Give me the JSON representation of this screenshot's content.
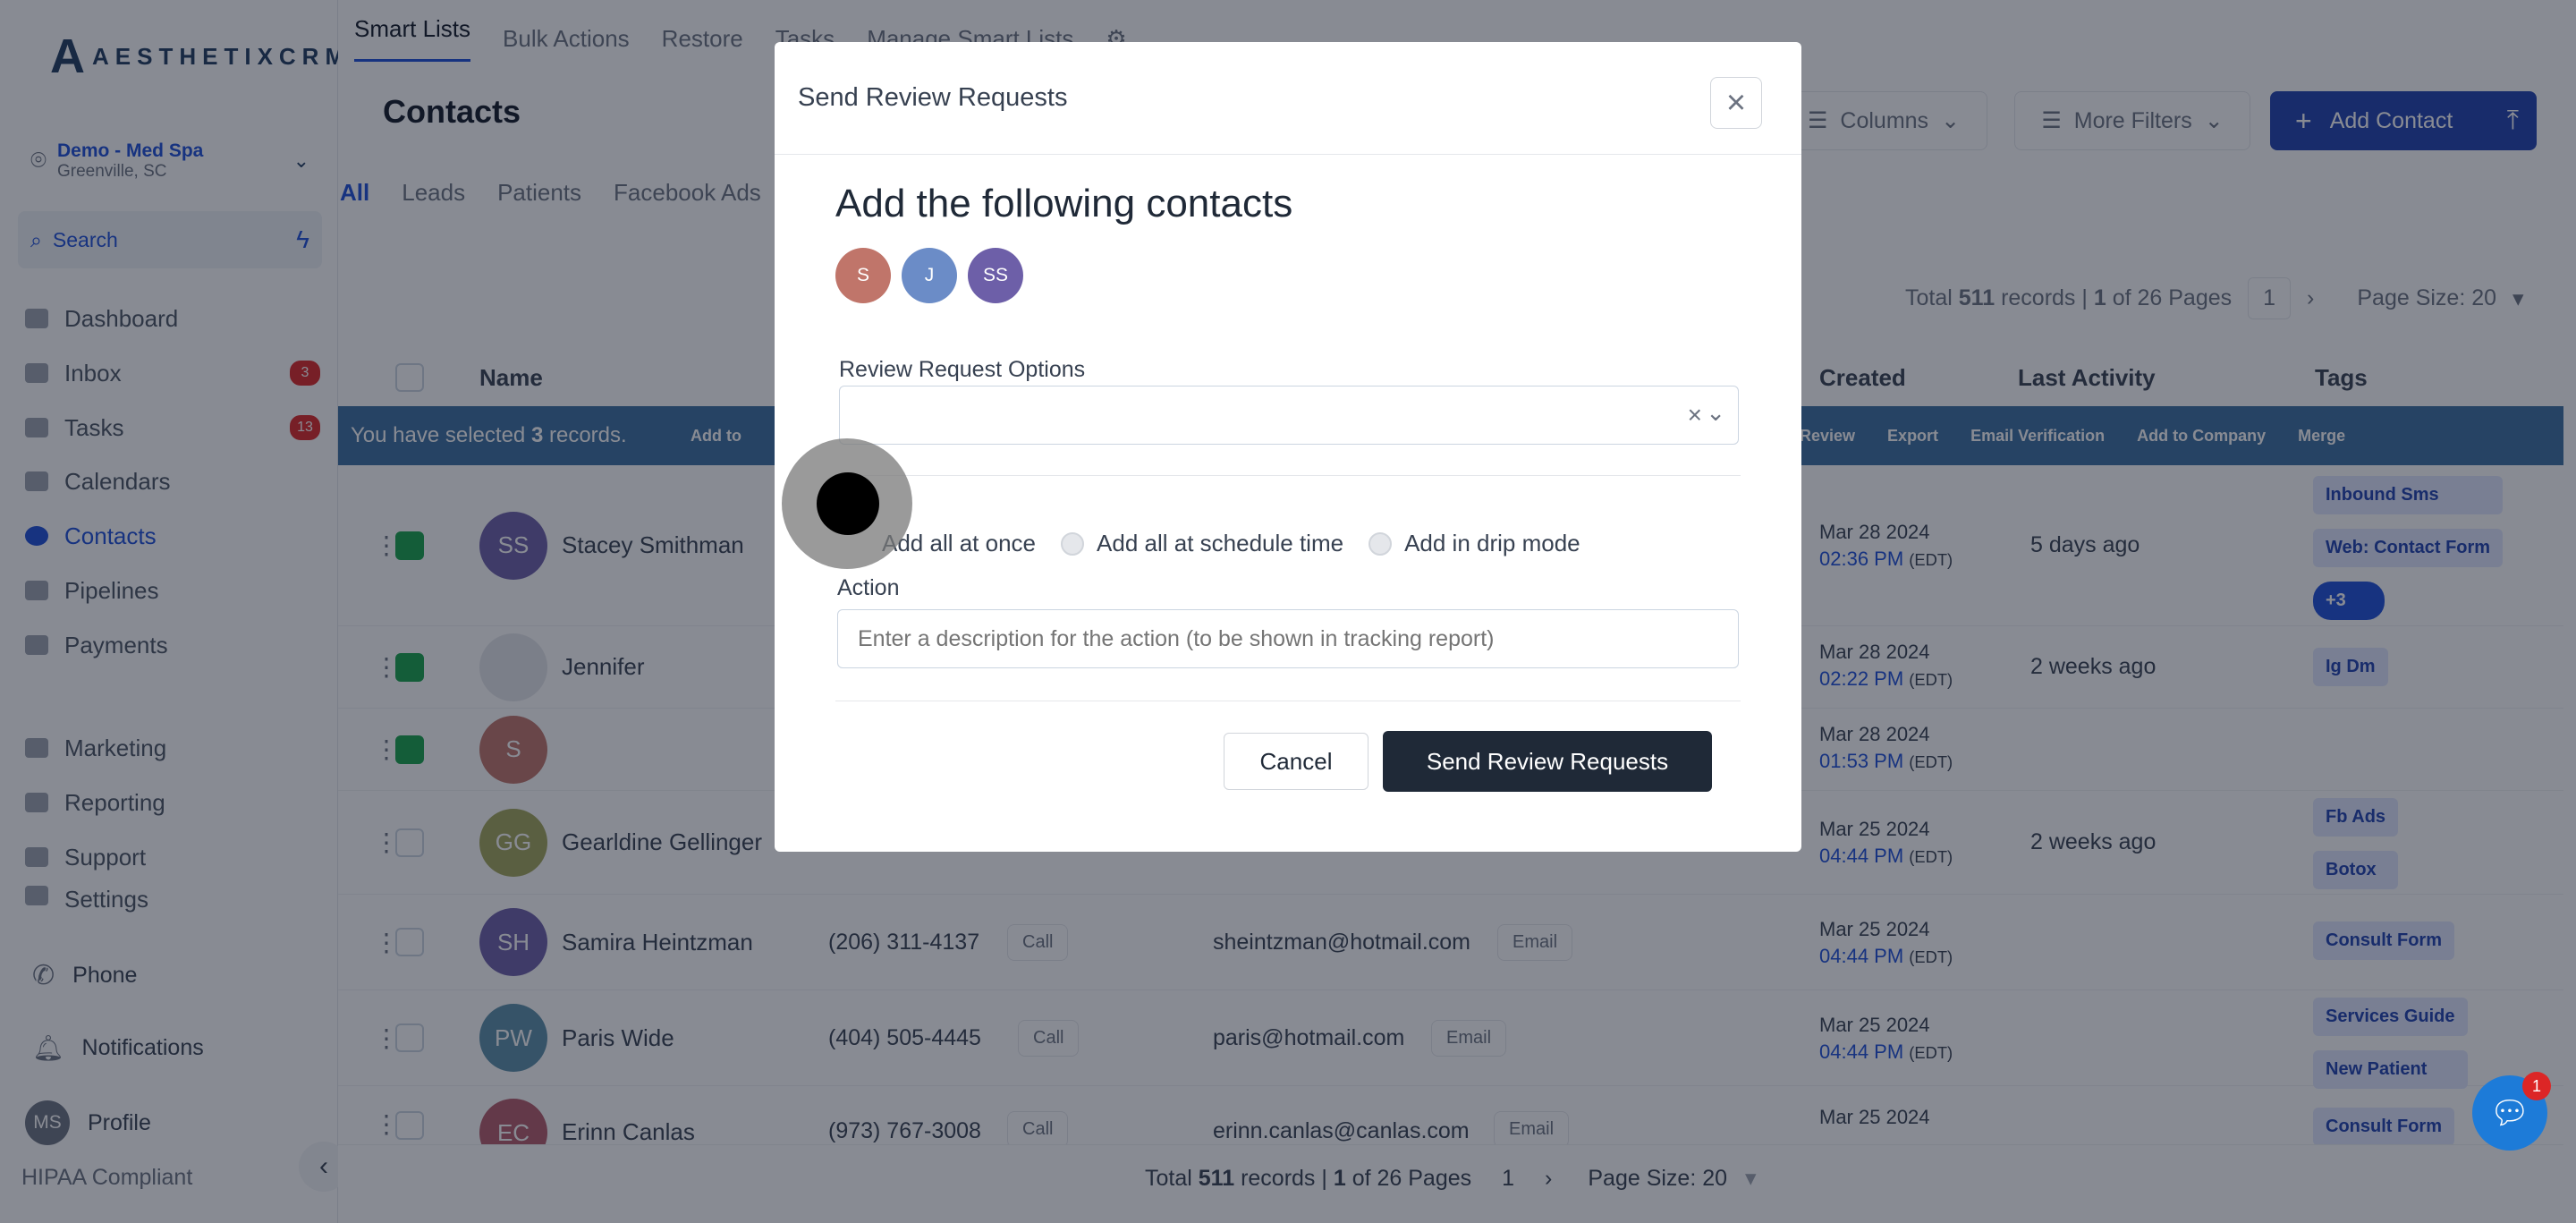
{
  "app": {
    "logo_text": "AESTHETIXCRM",
    "logo_mark": "A"
  },
  "location": {
    "name": "Demo - Med Spa",
    "city": "Greenville, SC"
  },
  "sidebar": {
    "search_label": "Search",
    "items": [
      {
        "label": "Dashboard",
        "badge": ""
      },
      {
        "label": "Inbox",
        "badge": "3"
      },
      {
        "label": "Tasks",
        "badge": "13"
      },
      {
        "label": "Calendars",
        "badge": ""
      },
      {
        "label": "Contacts",
        "badge": ""
      },
      {
        "label": "Pipelines",
        "badge": ""
      },
      {
        "label": "Payments",
        "badge": ""
      },
      {
        "label": "Marketing",
        "badge": ""
      },
      {
        "label": "Reporting",
        "badge": ""
      },
      {
        "label": "Support",
        "badge": ""
      },
      {
        "label": "Settings",
        "badge": ""
      }
    ],
    "phone": "Phone",
    "notifications": "Notifications",
    "profile_initials": "MS",
    "profile": "Profile",
    "hipaa": "HIPAA Compliant"
  },
  "topnav": {
    "items": [
      "Smart Lists",
      "Bulk Actions",
      "Restore",
      "Tasks",
      "Manage Smart Lists"
    ]
  },
  "page": {
    "title": "Contacts",
    "filters": [
      "All",
      "Leads",
      "Patients",
      "Facebook Ads"
    ],
    "columns_btn": "Columns",
    "more_filters_btn": "More Filters",
    "add_contact_btn": "Add Contact"
  },
  "pager_top": {
    "total_prefix": "Total",
    "total": "511",
    "records_of": "records |",
    "page": "1",
    "of_pages": "of 26 Pages",
    "current": "1",
    "page_size": "Page Size: 20"
  },
  "table": {
    "headers": {
      "name": "Name",
      "created": "Created",
      "last_activity": "Last Activity",
      "tags": "Tags"
    },
    "selection": {
      "prefix": "You have selected",
      "count": "3",
      "suffix": "records.",
      "add_to": "Add to",
      "actions": [
        "Review",
        "Export",
        "Email Verification",
        "Add to Company",
        "Merge"
      ]
    },
    "call_label": "Call",
    "email_label": "Email",
    "rows": [
      {
        "initials": "SS",
        "name": "Stacey Smithman",
        "phone": "",
        "email": "",
        "created_date": "Mar 28 2024",
        "created_time": "02:36 PM",
        "tz": "(EDT)",
        "activity": "5 days ago",
        "tags": [
          "Inbound Sms",
          "Web: Contact Form",
          "+3"
        ]
      },
      {
        "initials": "",
        "name": "Jennifer",
        "phone": "",
        "email": "",
        "created_date": "Mar 28 2024",
        "created_time": "02:22 PM",
        "tz": "(EDT)",
        "activity": "2 weeks ago",
        "tags": [
          "Ig Dm"
        ]
      },
      {
        "initials": "S",
        "name": "",
        "phone": "",
        "email": "",
        "created_date": "Mar 28 2024",
        "created_time": "01:53 PM",
        "tz": "(EDT)",
        "activity": "",
        "tags": []
      },
      {
        "initials": "GG",
        "name": "Gearldine Gellinger",
        "phone": "",
        "email": "",
        "created_date": "Mar 25 2024",
        "created_time": "04:44 PM",
        "tz": "(EDT)",
        "activity": "2 weeks ago",
        "tags": [
          "Fb Ads",
          "Botox"
        ]
      },
      {
        "initials": "SH",
        "name": "Samira Heintzman",
        "phone": "(206) 311-4137",
        "email": "sheintzman@hotmail.com",
        "created_date": "Mar 25 2024",
        "created_time": "04:44 PM",
        "tz": "(EDT)",
        "activity": "",
        "tags": [
          "Consult Form"
        ]
      },
      {
        "initials": "PW",
        "name": "Paris Wide",
        "phone": "(404) 505-4445",
        "email": "paris@hotmail.com",
        "created_date": "Mar 25 2024",
        "created_time": "04:44 PM",
        "tz": "(EDT)",
        "activity": "",
        "tags": [
          "Services Guide",
          "New Patient"
        ]
      },
      {
        "initials": "EC",
        "name": "Erinn Canlas",
        "phone": "(973) 767-3008",
        "email": "erinn.canlas@canlas.com",
        "created_date": "Mar 25 2024",
        "created_time": "",
        "tz": "",
        "activity": "",
        "tags": [
          "Consult Form"
        ]
      }
    ]
  },
  "pager_bottom": {
    "total_prefix": "Total",
    "total": "511",
    "records_of": "records |",
    "page": "1",
    "of_pages": "of 26 Pages",
    "current": "1",
    "page_size": "Page Size: 20"
  },
  "modal": {
    "title": "Send Review Requests",
    "heading": "Add the following contacts",
    "chips": [
      "S",
      "J",
      "SS"
    ],
    "options_label": "Review Request Options",
    "radio_options": [
      "Add all at once",
      "Add all at schedule time",
      "Add in drip mode"
    ],
    "action_label": "Action",
    "action_placeholder": "Enter a description for the action (to be shown in tracking report)",
    "cancel": "Cancel",
    "submit": "Send Review Requests"
  },
  "chat": {
    "badge": "1"
  },
  "colors": {
    "primary": "#1e40af",
    "selection_bar": "#3b6fa0",
    "submit": "#1f2937",
    "badge": "#dc2626",
    "checked": "#16a34a"
  }
}
